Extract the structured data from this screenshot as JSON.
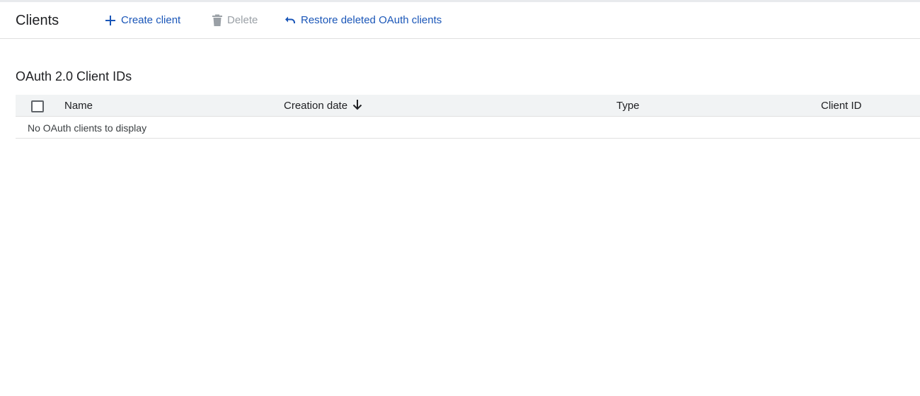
{
  "toolbar": {
    "title": "Clients",
    "create_label": "Create client",
    "delete_label": "Delete",
    "restore_label": "Restore deleted OAuth clients"
  },
  "section": {
    "title": "OAuth 2.0 Client IDs"
  },
  "table": {
    "columns": {
      "name": "Name",
      "creation_date": "Creation date",
      "type": "Type",
      "client_id": "Client ID"
    },
    "sort": {
      "column": "creation_date",
      "direction": "descending"
    },
    "empty_message": "No OAuth clients to display"
  },
  "colors": {
    "accent": "#1a56b8",
    "disabled": "#9aa0a6",
    "header_bg": "#f1f3f4",
    "divider": "#e0e0e0"
  },
  "icons": {
    "create": "plus-icon",
    "delete": "trash-icon",
    "restore": "undo-icon",
    "sort": "arrow-down-icon"
  }
}
